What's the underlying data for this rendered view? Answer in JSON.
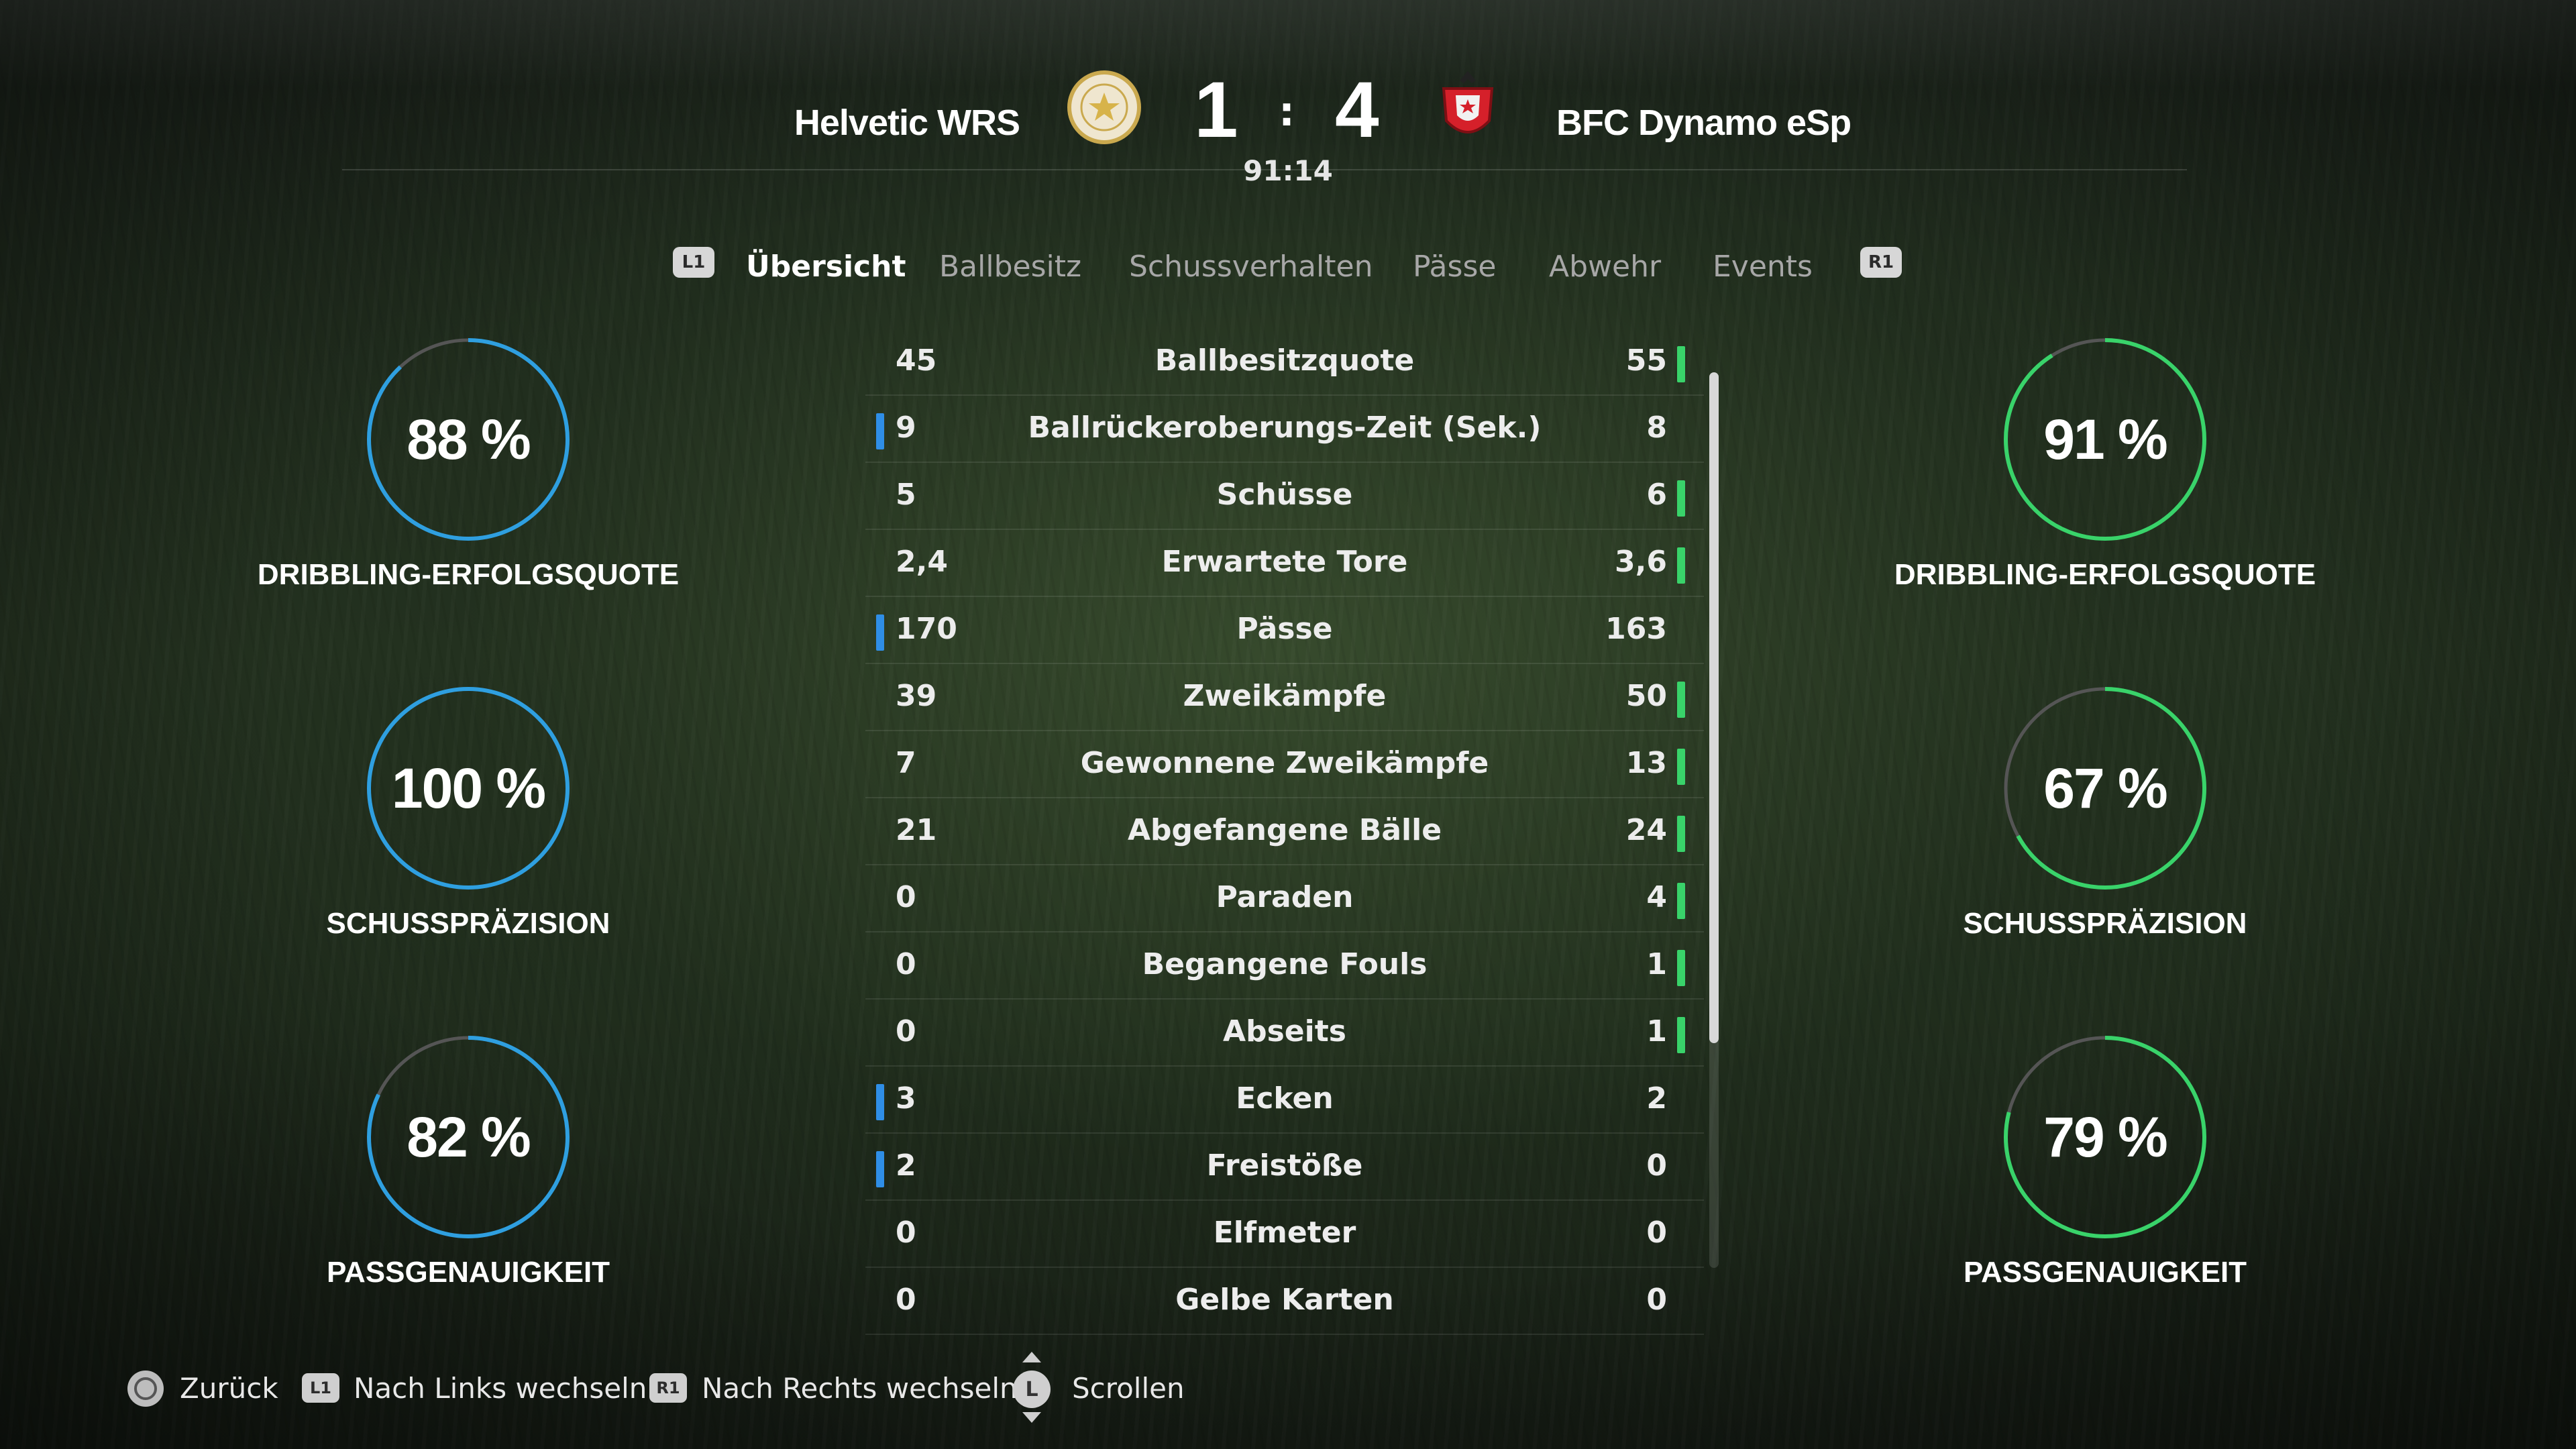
{
  "match": {
    "home_team": "Helvetic WRS",
    "away_team": "BFC Dynamo eSp",
    "home_score": "1",
    "away_score": "4",
    "separator": ":",
    "time": "91:14"
  },
  "tabs": {
    "left_shoulder": "L1",
    "right_shoulder": "R1",
    "items": [
      "Übersicht",
      "Ballbesitz",
      "Schussverhalten",
      "Pässe",
      "Abwehr",
      "Events"
    ],
    "active_index": 0
  },
  "colors": {
    "home_accent": "#2f9fe0",
    "away_accent": "#39d36a",
    "ring_track": "#555555"
  },
  "home_circles": [
    {
      "value": "88 %",
      "fraction": 0.88,
      "label": "DRIBBLING-ERFOLGSQUOTE"
    },
    {
      "value": "100 %",
      "fraction": 1.0,
      "label": "SCHUSSPRÄZISION"
    },
    {
      "value": "82 %",
      "fraction": 0.82,
      "label": "PASSGENAUIGKEIT"
    }
  ],
  "away_circles": [
    {
      "value": "91 %",
      "fraction": 0.91,
      "label": "DRIBBLING-ERFOLGSQUOTE"
    },
    {
      "value": "67 %",
      "fraction": 0.67,
      "label": "SCHUSSPRÄZISION"
    },
    {
      "value": "79 %",
      "fraction": 0.79,
      "label": "PASSGENAUIGKEIT"
    }
  ],
  "stats": [
    {
      "label": "Ballbesitzquote",
      "home": "45",
      "away": "55",
      "leader": "away"
    },
    {
      "label": "Ballrückeroberungs-Zeit (Sek.)",
      "home": "9",
      "away": "8",
      "leader": "home"
    },
    {
      "label": "Schüsse",
      "home": "5",
      "away": "6",
      "leader": "away"
    },
    {
      "label": "Erwartete Tore",
      "home": "2,4",
      "away": "3,6",
      "leader": "away"
    },
    {
      "label": "Pässe",
      "home": "170",
      "away": "163",
      "leader": "home"
    },
    {
      "label": "Zweikämpfe",
      "home": "39",
      "away": "50",
      "leader": "away"
    },
    {
      "label": "Gewonnene Zweikämpfe",
      "home": "7",
      "away": "13",
      "leader": "away"
    },
    {
      "label": "Abgefangene Bälle",
      "home": "21",
      "away": "24",
      "leader": "away"
    },
    {
      "label": "Paraden",
      "home": "0",
      "away": "4",
      "leader": "away"
    },
    {
      "label": "Begangene Fouls",
      "home": "0",
      "away": "1",
      "leader": "away"
    },
    {
      "label": "Abseits",
      "home": "0",
      "away": "1",
      "leader": "away"
    },
    {
      "label": "Ecken",
      "home": "3",
      "away": "2",
      "leader": "home"
    },
    {
      "label": "Freistöße",
      "home": "2",
      "away": "0",
      "leader": "home"
    },
    {
      "label": "Elfmeter",
      "home": "0",
      "away": "0",
      "leader": "none"
    },
    {
      "label": "Gelbe Karten",
      "home": "0",
      "away": "0",
      "leader": "none"
    }
  ],
  "footer": {
    "back": "Zurück",
    "left_key": "L1",
    "left": "Nach Links wechseln",
    "right_key": "R1",
    "right": "Nach Rechts wechseln",
    "stick_key": "L",
    "scroll": "Scrollen"
  }
}
